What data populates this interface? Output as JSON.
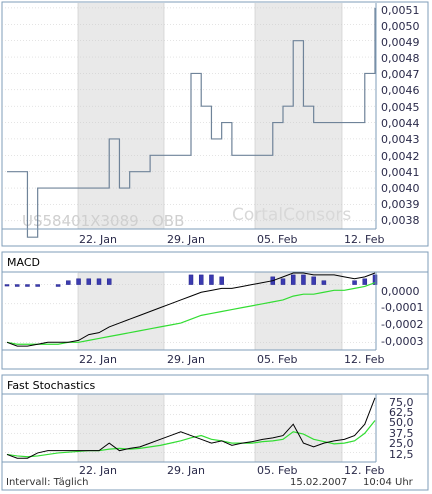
{
  "footer": {
    "interval": "Intervall: Täglich",
    "date": "15.02.2007",
    "time": "10:04 Uhr"
  },
  "watermark": {
    "isin": "US58401X3089",
    "exchange": "OBB",
    "brand": "CortalConsors"
  },
  "colors": {
    "price_line": "#6f8399",
    "shade": "#e9e9e9",
    "frame": "#7f9db9",
    "grid": "#c8c8c8",
    "macd_bar": "#3b3bb0",
    "macd_line": "#000000",
    "signal_line": "#33dd33",
    "stoch_k": "#000000",
    "stoch_d": "#33dd33"
  },
  "chart_data": [
    {
      "type": "line",
      "title": "",
      "x_labels": [
        "22. Jan",
        "29. Jan",
        "05. Feb",
        "12. Feb"
      ],
      "y_ticks": [
        "0,0038",
        "0,0039",
        "0,0040",
        "0,0041",
        "0,0042",
        "0,0043",
        "0,0044",
        "0,0045",
        "0,0046",
        "0,0047",
        "0,0048",
        "0,0049",
        "0,0050",
        "0,0051"
      ],
      "ylim": [
        0.00375,
        0.00513
      ],
      "grid": true,
      "series": [
        {
          "values": [
            0.0041,
            0.0041,
            0.0037,
            0.004,
            0.004,
            0.004,
            0.004,
            0.004,
            0.004,
            0.004,
            0.0043,
            0.004,
            0.0041,
            0.0041,
            0.0042,
            0.0042,
            0.0042,
            0.0042,
            0.0047,
            0.0045,
            0.0043,
            0.0044,
            0.0042,
            0.0042,
            0.0042,
            0.0042,
            0.0044,
            0.0045,
            0.0049,
            0.0045,
            0.0044,
            0.0044,
            0.0044,
            0.0044,
            0.0044,
            0.0047,
            0.0051
          ]
        }
      ]
    },
    {
      "type": "bar",
      "title": "MACD",
      "x_labels": [
        "22. Jan",
        "29. Jan",
        "05. Feb",
        "12. Feb"
      ],
      "y_ticks": [
        "0,0000",
        "-0,0001",
        "-0,0002",
        "-0,0003"
      ],
      "ylim": [
        -0.00034,
        6e-05
      ],
      "grid": true,
      "series": [
        {
          "name": "histogram",
          "values": [
            0.0,
            -1e-05,
            -1e-05,
            -1e-05,
            null,
            -1e-05,
            2e-05,
            3e-05,
            3e-05,
            3e-05,
            3e-05,
            null,
            null,
            null,
            null,
            null,
            null,
            null,
            5e-05,
            5e-05,
            5e-05,
            4e-05,
            null,
            null,
            null,
            null,
            4e-05,
            3e-05,
            5e-05,
            5e-05,
            4e-05,
            2e-05,
            null,
            null,
            2e-05,
            3e-05,
            5e-05
          ]
        },
        {
          "name": "macd",
          "values": [
            -0.0003,
            -0.00032,
            -0.00032,
            -0.00031,
            -0.0003,
            -0.0003,
            -0.0003,
            -0.00029,
            -0.00026,
            -0.00025,
            -0.00022,
            -0.0002,
            -0.00018,
            -0.00016,
            -0.00014,
            -0.00012,
            -0.0001,
            -8e-05,
            -6e-05,
            -4e-05,
            -3e-05,
            -2e-05,
            -2e-05,
            -1e-05,
            0.0,
            1e-05,
            2e-05,
            4e-05,
            6e-05,
            6e-05,
            5e-05,
            5e-05,
            5e-05,
            4e-05,
            3e-05,
            4e-05,
            6e-05
          ]
        },
        {
          "name": "signal",
          "values": [
            -0.0003,
            -0.00031,
            -0.00031,
            -0.00031,
            -0.00031,
            -0.00031,
            -0.0003,
            -0.0003,
            -0.00029,
            -0.00028,
            -0.00027,
            -0.00026,
            -0.00025,
            -0.00024,
            -0.00023,
            -0.00022,
            -0.00021,
            -0.0002,
            -0.00018,
            -0.00016,
            -0.00015,
            -0.00014,
            -0.00013,
            -0.00012,
            -0.00011,
            -0.0001,
            -9e-05,
            -8e-05,
            -6e-05,
            -5e-05,
            -5e-05,
            -4e-05,
            -3e-05,
            -3e-05,
            -2e-05,
            -1e-05,
            1e-05
          ]
        }
      ]
    },
    {
      "type": "line",
      "title": "Fast Stochastics",
      "x_labels": [
        "22. Jan",
        "29. Jan",
        "05. Feb",
        "12. Feb"
      ],
      "y_ticks": [
        "12,5",
        "25,0",
        "37,5",
        "50,0",
        "62,5",
        "75,0"
      ],
      "ylim": [
        0,
        90
      ],
      "grid": true,
      "series": [
        {
          "name": "%K",
          "values": [
            10,
            5,
            5,
            12,
            15,
            15,
            15,
            15,
            15,
            15,
            25,
            15,
            18,
            20,
            25,
            30,
            35,
            40,
            35,
            30,
            25,
            28,
            22,
            25,
            27,
            30,
            32,
            35,
            50,
            25,
            20,
            25,
            28,
            30,
            35,
            50,
            85
          ]
        },
        {
          "name": "%D",
          "values": [
            10,
            8,
            7,
            8,
            10,
            12,
            13,
            14,
            15,
            15,
            17,
            18,
            17,
            18,
            20,
            22,
            25,
            28,
            32,
            35,
            30,
            28,
            25,
            25,
            25,
            27,
            28,
            30,
            40,
            37,
            30,
            27,
            24,
            25,
            28,
            38,
            55
          ]
        }
      ]
    }
  ]
}
